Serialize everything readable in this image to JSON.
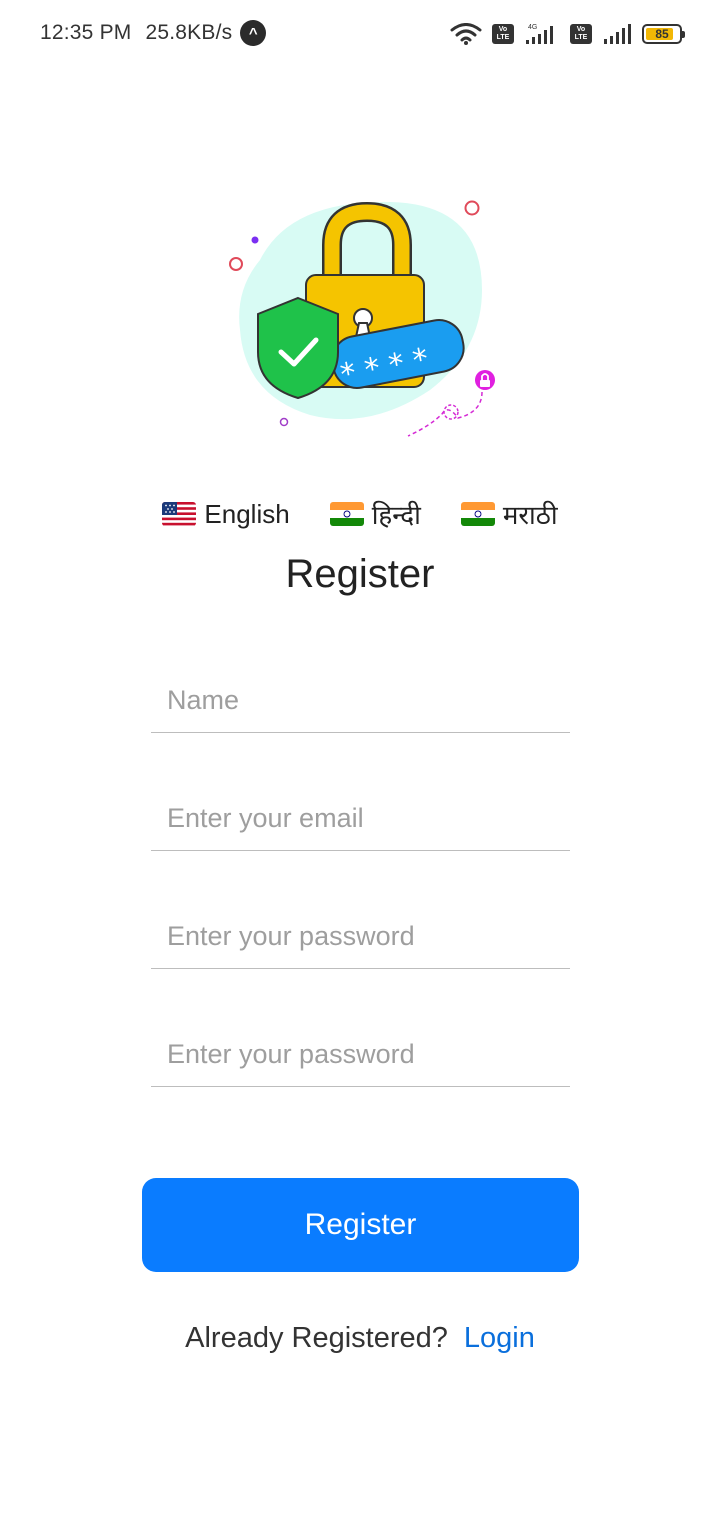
{
  "status_bar": {
    "time": "12:35 PM",
    "speed": "25.8KB/s",
    "network_label": "4G",
    "volte_label": "Vo LTE",
    "battery": "85",
    "battery_level": 0.85
  },
  "languages": [
    {
      "label": "English",
      "flag": "us-flag-icon"
    },
    {
      "label": "हिन्दी",
      "flag": "india-flag-icon"
    },
    {
      "label": "मराठी",
      "flag": "india-flag-icon"
    }
  ],
  "title": "Register",
  "form": {
    "name_placeholder": "Name",
    "email_placeholder": "Enter your email",
    "password_placeholder": "Enter your password",
    "confirm_password_placeholder": "Enter your password",
    "submit_label": "Register"
  },
  "footer": {
    "text": "Already Registered?",
    "link": "Login"
  },
  "colors": {
    "primary": "#0a7cff",
    "link": "#0a6fdc",
    "lock_yellow": "#f5c400",
    "shield_green": "#1fc24a",
    "password_bar": "#1a9df0",
    "blob": "#d8fbf4"
  }
}
